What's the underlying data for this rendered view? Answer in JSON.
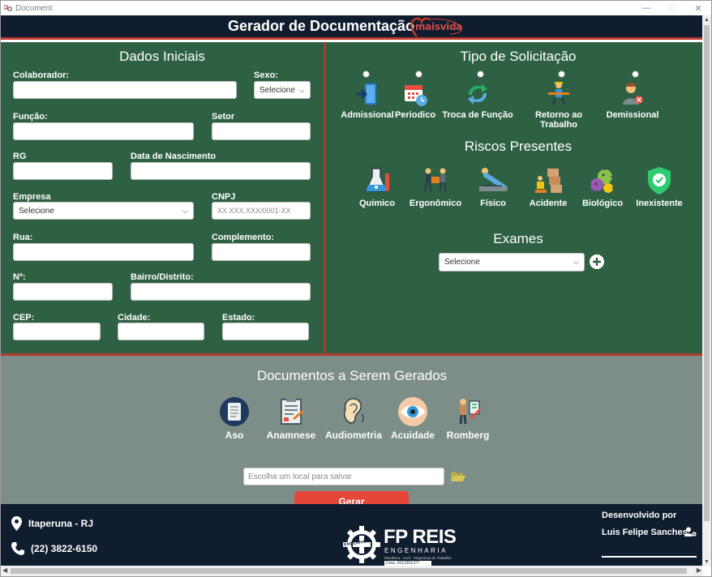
{
  "window": {
    "title": "Document"
  },
  "header": {
    "title": "Gerador de Documentação",
    "logo_text": "maisvida"
  },
  "dados_iniciais": {
    "title": "Dados Iniciais",
    "colaborador_label": "Colaborador:",
    "sexo_label": "Sexo:",
    "sexo_value": "Selecione",
    "funcao_label": "Função:",
    "setor_label": "Setor",
    "rg_label": "RG",
    "nascimento_label": "Data de Nascimento",
    "empresa_label": "Empresa",
    "empresa_value": "Selecione",
    "cnpj_label": "CNPJ",
    "cnpj_placeholder": "XX.XXX.XXX/0001-XX",
    "rua_label": "Rua:",
    "complemento_label": "Complemento:",
    "numero_label": "Nº:",
    "bairro_label": "Bairro/Distrito:",
    "cep_label": "CEP:",
    "cidade_label": "Cidade:",
    "estado_label": "Estado:"
  },
  "tipo_solicitacao": {
    "title": "Tipo de Solicitação",
    "items": [
      {
        "label": "Admissional",
        "icon": "door-enter-icon"
      },
      {
        "label": "Periodico",
        "icon": "calendar-clock-icon"
      },
      {
        "label": "Troca de Função",
        "icon": "swap-arrows-icon"
      },
      {
        "label": "Retorno ao Trabalho",
        "icon": "worker-return-icon"
      },
      {
        "label": "Demissional",
        "icon": "dismissed-person-icon"
      }
    ]
  },
  "riscos": {
    "title": "Riscos Presentes",
    "items": [
      {
        "label": "Químico",
        "icon": "flask-icon"
      },
      {
        "label": "Ergonômico",
        "icon": "ergonomic-lifting-icon"
      },
      {
        "label": "Físico",
        "icon": "physical-exercise-icon"
      },
      {
        "label": "Acidente",
        "icon": "accident-boxes-icon"
      },
      {
        "label": "Biológico",
        "icon": "virus-icon"
      },
      {
        "label": "Inexistente",
        "icon": "shield-check-icon"
      }
    ]
  },
  "exames": {
    "title": "Exames",
    "select_value": "Selecione"
  },
  "documentos": {
    "title": "Documentos a Serem Gerados",
    "items": [
      {
        "label": "Aso",
        "icon": "notebook-icon"
      },
      {
        "label": "Anamnese",
        "icon": "clipboard-form-icon"
      },
      {
        "label": "Audiometria",
        "icon": "ear-icon"
      },
      {
        "label": "Acuidade",
        "icon": "eye-icon"
      },
      {
        "label": "Romberg",
        "icon": "balance-test-icon"
      }
    ],
    "save_placeholder": "Escolha um local para salvar",
    "gerar_label": "Gerar"
  },
  "footer": {
    "city": "Itaperuna - RJ",
    "phone": "(22) 3822-6150",
    "dev_label": "Desenvolvido por",
    "dev_name": "Luis Felipe Sanches",
    "company_name": "FP REIS",
    "company_sub": "ENGENHARIA",
    "company_tagline": "Mecânica - Civil - Segurança do Trabalho",
    "company_reg": "Crea: 2012201377",
    "seal_text": "ENGENHARIA"
  },
  "colors": {
    "panel_green": "#2e6143",
    "header_navy": "#0f1d2e",
    "accent_red": "#c0392b",
    "button_red": "#e4463a",
    "bottom_gray": "#7d8d87"
  }
}
